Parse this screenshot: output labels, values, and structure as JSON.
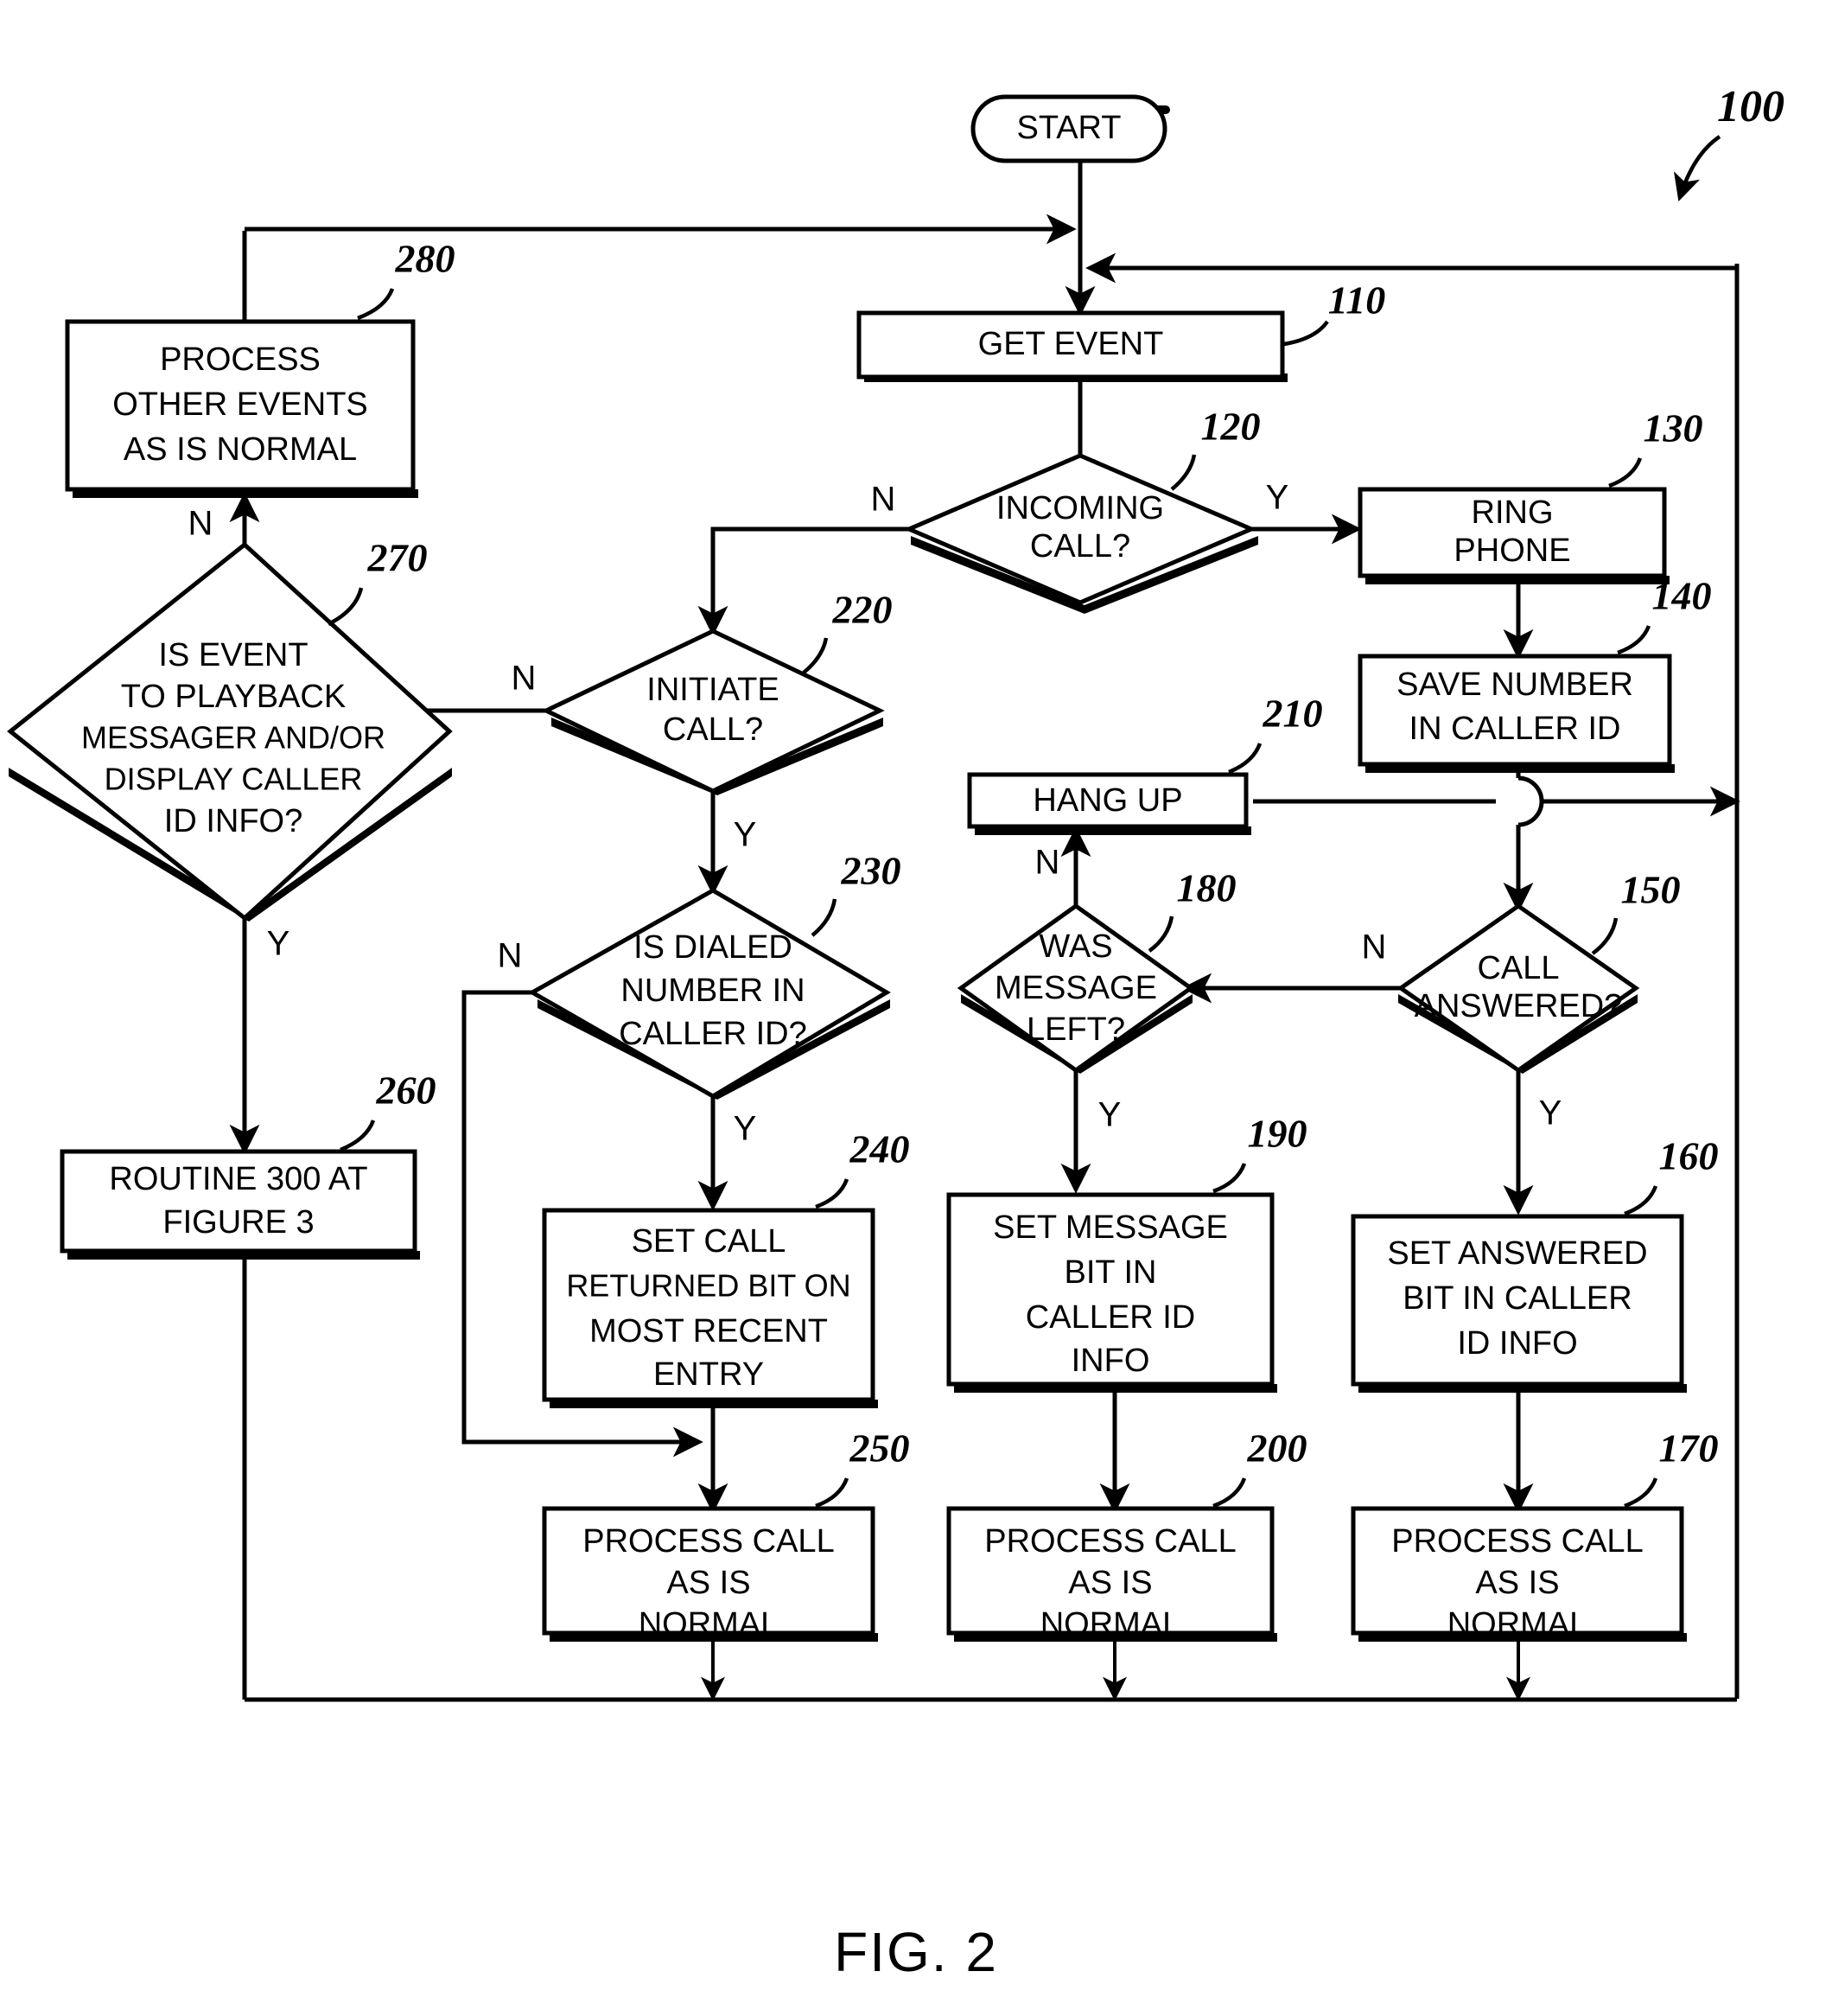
{
  "figure": {
    "caption": "FIG. 2",
    "diagram_ref": "100"
  },
  "nodes": {
    "start": {
      "ref": "",
      "text": "START",
      "shape": "terminal"
    },
    "get_event": {
      "ref": "110",
      "text": "GET EVENT",
      "shape": "process"
    },
    "incoming": {
      "ref": "120",
      "text": "INCOMING\nCALL?",
      "shape": "decision"
    },
    "ring": {
      "ref": "130",
      "text": "RING\nPHONE",
      "shape": "process"
    },
    "save_num": {
      "ref": "140",
      "text": "SAVE NUMBER\nIN CALLER ID",
      "shape": "process"
    },
    "answered": {
      "ref": "150",
      "text": "CALL\nANSWERED?",
      "shape": "decision"
    },
    "set_ans": {
      "ref": "160",
      "text": "SET ANSWERED\nBIT IN CALLER\nID INFO",
      "shape": "process"
    },
    "proc_170": {
      "ref": "170",
      "text": "PROCESS CALL\nAS IS\nNORMAL",
      "shape": "process"
    },
    "msg_left": {
      "ref": "180",
      "text": "WAS\nMESSAGE\nLEFT?",
      "shape": "decision"
    },
    "set_msg": {
      "ref": "190",
      "text": "SET MESSAGE\nBIT IN\nCALLER ID\nINFO",
      "shape": "process"
    },
    "proc_200": {
      "ref": "200",
      "text": "PROCESS CALL\nAS IS\nNORMAL",
      "shape": "process"
    },
    "hang_up": {
      "ref": "210",
      "text": "HANG UP",
      "shape": "process"
    },
    "initiate": {
      "ref": "220",
      "text": "INITIATE\nCALL?",
      "shape": "decision"
    },
    "dialed": {
      "ref": "230",
      "text": "IS DIALED\nNUMBER IN\nCALLER ID?",
      "shape": "decision"
    },
    "set_ret": {
      "ref": "240",
      "text": "SET CALL\nRETURNED BIT ON\nMOST RECENT\nENTRY",
      "shape": "process"
    },
    "proc_250": {
      "ref": "250",
      "text": "PROCESS CALL\nAS IS\nNORMAL",
      "shape": "process"
    },
    "routine": {
      "ref": "260",
      "text": "ROUTINE 300 AT\nFIGURE 3",
      "shape": "process"
    },
    "playback": {
      "ref": "270",
      "text": "IS EVENT\nTO PLAYBACK\nMESSAGER AND/OR\nDISPLAY CALLER\nID INFO?",
      "shape": "decision"
    },
    "proc_other": {
      "ref": "280",
      "text": "PROCESS\nOTHER EVENTS\nAS IS NORMAL",
      "shape": "process"
    }
  },
  "branch_labels": {
    "incoming_n": "N",
    "incoming_y": "Y",
    "initiate_n": "N",
    "initiate_y": "Y",
    "dialed_n": "N",
    "dialed_y": "Y",
    "answered_n": "N",
    "answered_y": "Y",
    "msg_left_n": "N",
    "msg_left_y": "Y",
    "playback_n": "N",
    "playback_y": "Y"
  },
  "style": {
    "stroke": "#000000",
    "fill": "#ffffff",
    "background": "#ffffff"
  }
}
